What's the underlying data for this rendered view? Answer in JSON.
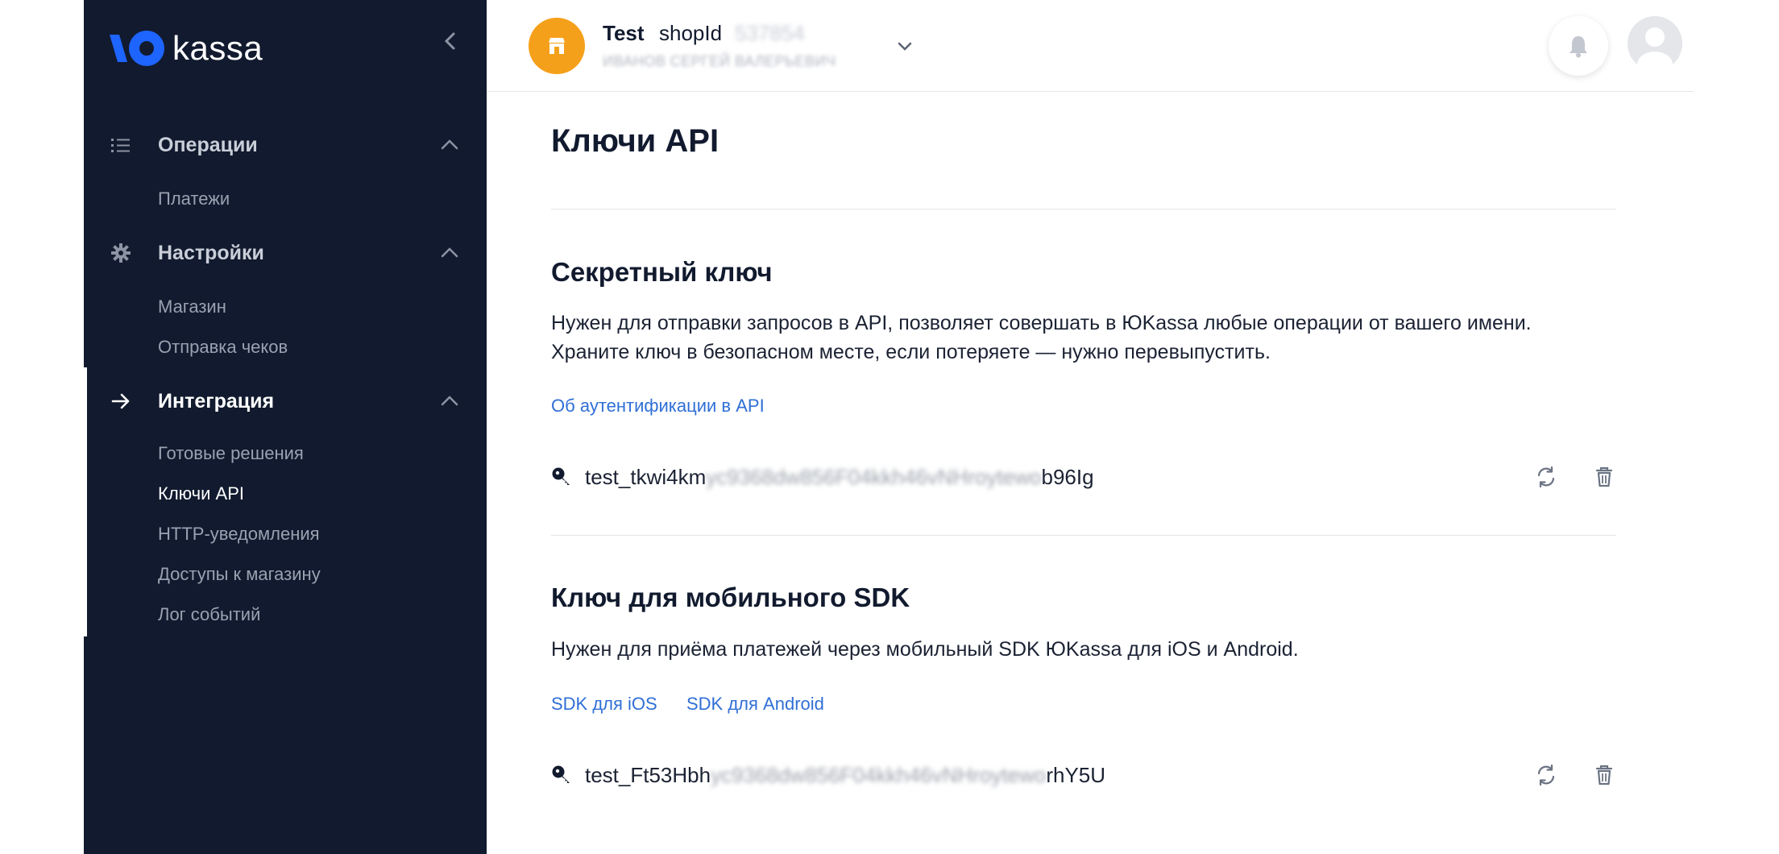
{
  "brand": {
    "name": "kassa",
    "accent": "#1e64ff"
  },
  "sidebar": {
    "collapse_icon": "chevron-left-icon",
    "sections": [
      {
        "label": "Операции",
        "icon": "list-icon",
        "items": [
          "Платежи"
        ]
      },
      {
        "label": "Настройки",
        "icon": "gear-icon",
        "items": [
          "Магазин",
          "Отправка чеков"
        ]
      },
      {
        "label": "Интеграция",
        "icon": "arrow-right-icon",
        "items": [
          "Готовые решения",
          "Ключи API",
          "HTTP-уведомления",
          "Доступы к магазину",
          "Лог событий"
        ]
      }
    ],
    "active_item": "Ключи API"
  },
  "header": {
    "shop_name": "Test",
    "shop_id_label": "shopId",
    "shop_id_value": "537854",
    "shop_owner": "ИВАНОВ СЕРГЕЙ ВАЛЕРЬЕВИЧ",
    "avatar_color": "#f5a01a"
  },
  "page": {
    "title": "Ключи API",
    "secret": {
      "title": "Секретный ключ",
      "description_line1": "Нужен для отправки запросов в API, позволяет совершать в ЮKassa любые операции от вашего имени.",
      "description_line2": "Храните ключ в безопасном месте, если потеряете — нужно перевыпустить.",
      "link": "Об аутентификации в API",
      "key_prefix": "test_tkwi4km",
      "key_hidden": "yc9368dw856F04kkh46vNHroytewo",
      "key_suffix": "b96Ig"
    },
    "sdk": {
      "title": "Ключ для мобильного SDK",
      "description": "Нужен для приёма платежей через мобильный SDK ЮKassa для iOS и Android.",
      "link_ios": "SDK для iOS",
      "link_android": "SDK для Android",
      "key_prefix": "test_Ft53Hbh",
      "key_hidden": "yc9368dw856F04kkh46vNHroytewo",
      "key_suffix": "rhY5U"
    }
  }
}
